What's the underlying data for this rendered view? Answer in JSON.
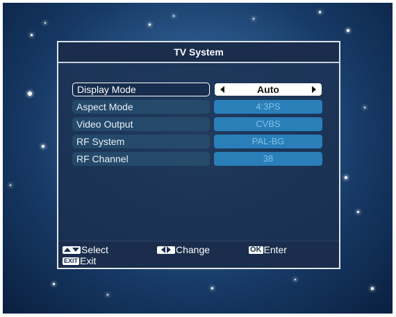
{
  "dialog": {
    "title": "TV System"
  },
  "settings": [
    {
      "label": "Display Mode",
      "value": "Auto",
      "active": true
    },
    {
      "label": "Aspect Mode",
      "value": "4:3PS"
    },
    {
      "label": "Video Output",
      "value": "CVBS"
    },
    {
      "label": "RF System",
      "value": "PAL-BG"
    },
    {
      "label": "RF Channel",
      "value": "38"
    }
  ],
  "footer": {
    "select_label": "Select",
    "change_label": "Change",
    "enter_key": "OK",
    "enter_label": "Enter",
    "exit_key": "EXIT",
    "exit_label": "Exit"
  },
  "colors": {
    "panel": "#1a2d4c",
    "value_bg": "#2a7fb8",
    "selected_bg": "#ffffff"
  }
}
